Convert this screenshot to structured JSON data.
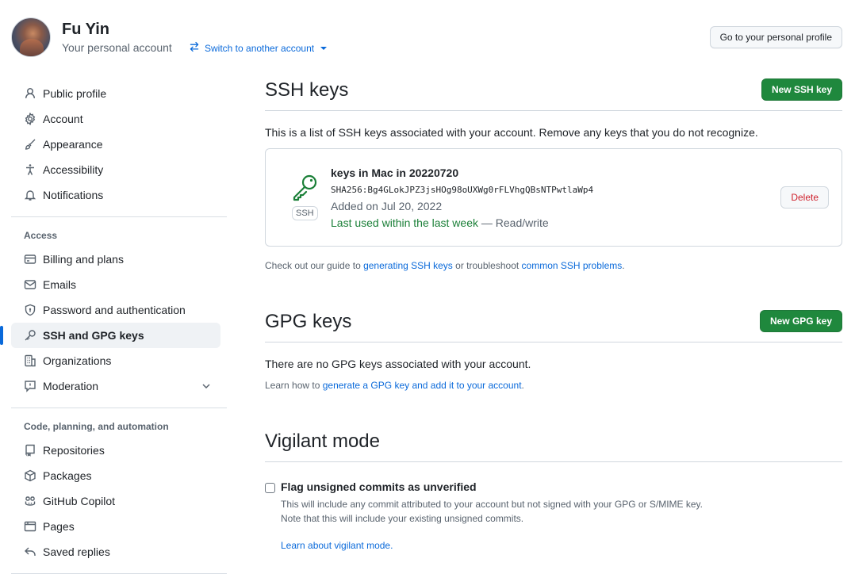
{
  "user": {
    "name": "Fu Yin",
    "subtitle": "Your personal account",
    "switch_label": "Switch to another account",
    "profile_button": "Go to your personal profile"
  },
  "sidebar": {
    "top_items": [
      {
        "label": "Public profile",
        "icon": "person-icon"
      },
      {
        "label": "Account",
        "icon": "gear-icon"
      },
      {
        "label": "Appearance",
        "icon": "paintbrush-icon"
      },
      {
        "label": "Accessibility",
        "icon": "accessibility-icon"
      },
      {
        "label": "Notifications",
        "icon": "bell-icon"
      }
    ],
    "access_title": "Access",
    "access_items": [
      {
        "label": "Billing and plans",
        "icon": "credit-card-icon"
      },
      {
        "label": "Emails",
        "icon": "mail-icon"
      },
      {
        "label": "Password and authentication",
        "icon": "shield-lock-icon"
      },
      {
        "label": "SSH and GPG keys",
        "icon": "key-icon",
        "active": true
      },
      {
        "label": "Organizations",
        "icon": "organization-icon"
      },
      {
        "label": "Moderation",
        "icon": "report-icon"
      }
    ],
    "code_title": "Code, planning, and automation",
    "code_items": [
      {
        "label": "Repositories",
        "icon": "repo-icon"
      },
      {
        "label": "Packages",
        "icon": "package-icon"
      },
      {
        "label": "GitHub Copilot",
        "icon": "copilot-icon"
      },
      {
        "label": "Pages",
        "icon": "browser-icon"
      },
      {
        "label": "Saved replies",
        "icon": "reply-icon"
      }
    ]
  },
  "ssh": {
    "title": "SSH keys",
    "new_button": "New SSH key",
    "description": "This is a list of SSH keys associated with your account. Remove any keys that you do not recognize.",
    "key": {
      "badge": "SSH",
      "name": "keys in Mac in 20220720",
      "fingerprint": "SHA256:Bg4GLokJPZ3jsHOg98oUXWg0rFLVhgQBsNTPwtlaWp4",
      "added": "Added on Jul 20, 2022",
      "last_used": "Last used within the last week",
      "access": " — Read/write",
      "delete_button": "Delete"
    },
    "help_prefix": "Check out our guide to ",
    "help_link1": "generating SSH keys",
    "help_middle": " or troubleshoot ",
    "help_link2": "common SSH problems",
    "help_suffix": "."
  },
  "gpg": {
    "title": "GPG keys",
    "new_button": "New GPG key",
    "description": "There are no GPG keys associated with your account.",
    "help_prefix": "Learn how to ",
    "help_link": "generate a GPG key and add it to your account",
    "help_suffix": "."
  },
  "vigilant": {
    "title": "Vigilant mode",
    "checkbox_label": "Flag unsigned commits as unverified",
    "desc_line1": "This will include any commit attributed to your account but not signed with your GPG or S/MIME key.",
    "desc_line2": "Note that this will include your existing unsigned commits.",
    "link": "Learn about vigilant mode."
  },
  "colors": {
    "accent": "#0969da",
    "green_button": "#1f883d",
    "success_text": "#1a7f37",
    "danger_text": "#cf222e"
  }
}
